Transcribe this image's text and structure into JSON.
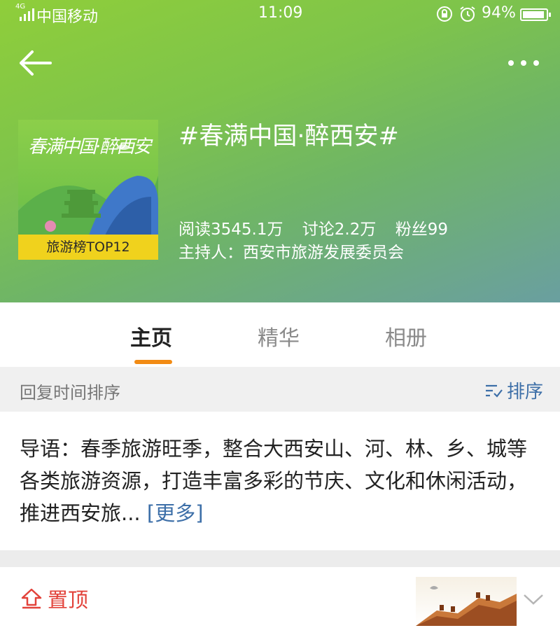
{
  "status_bar": {
    "network": "4G",
    "carrier": "中国移动",
    "time": "11:09",
    "battery": "94%",
    "battery_level": 0.94
  },
  "topic": {
    "title": "#春满中国·醉西安#",
    "cover_badge": "旅游榜TOP12",
    "cover_calligraphy": "春满中国·醉西安",
    "stats": {
      "reads": "阅读3545.1万",
      "discussions": "讨论2.2万",
      "fans": "粉丝99"
    },
    "host": "主持人：西安市旅游发展委员会"
  },
  "tabs": [
    {
      "label": "主页",
      "active": true
    },
    {
      "label": "精华",
      "active": false
    },
    {
      "label": "相册",
      "active": false
    }
  ],
  "sort": {
    "label": "回复时间排序",
    "button": "排序"
  },
  "intro": {
    "text": "导语：春季旅游旺季，整合大西安山、河、林、乡、城等各类旅游资源，打造丰富多彩的节庆、文化和休闲活动，推进西安旅...",
    "more": "[更多]"
  },
  "pinned": {
    "label": "置顶"
  },
  "colors": {
    "accent_orange": "#f28b14",
    "link_blue": "#3d6fa8",
    "pin_red": "#e2423a"
  },
  "icons": [
    "back-arrow-icon",
    "more-dots-icon",
    "sort-icon",
    "pin-up-icon",
    "chevron-down-icon",
    "alarm-icon",
    "lock-rotate-icon",
    "signal-icon",
    "battery-icon"
  ]
}
